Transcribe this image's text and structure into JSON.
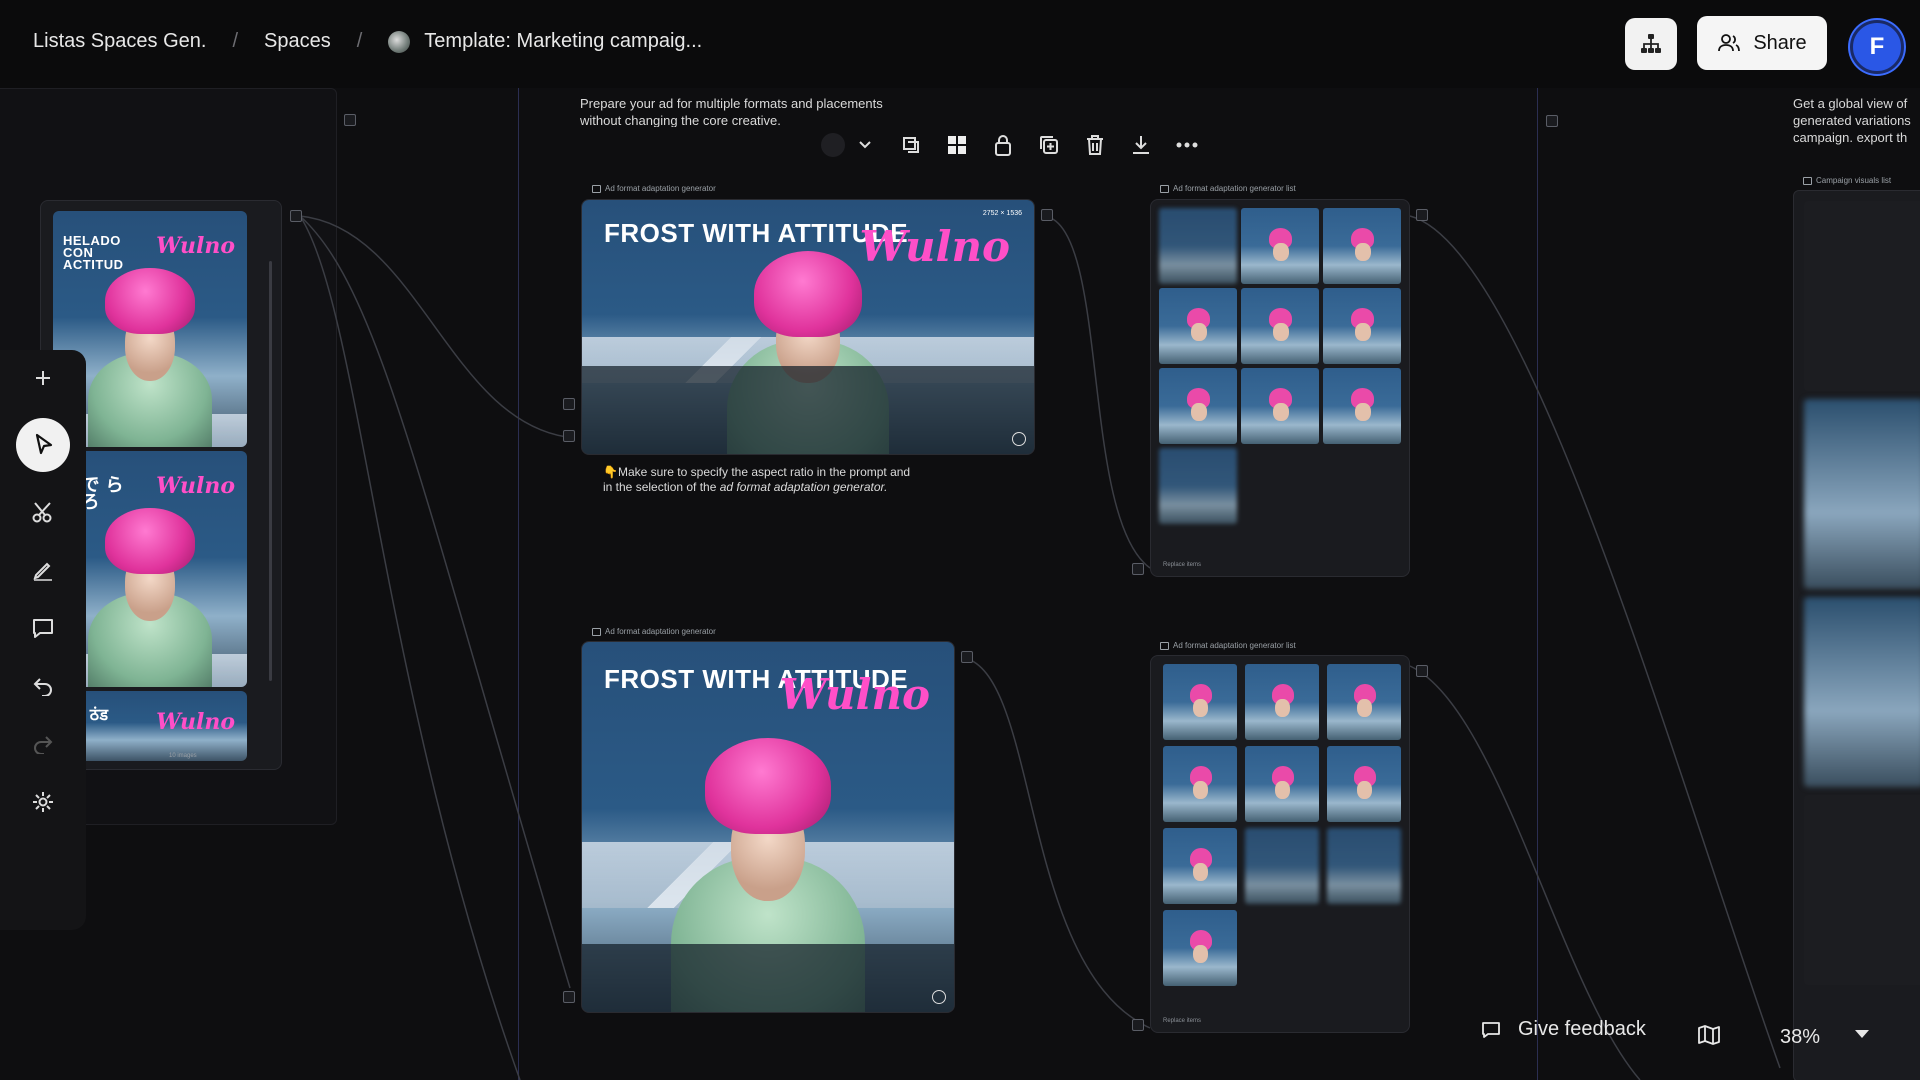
{
  "breadcrumb": {
    "items": [
      "Listas Spaces Gen.",
      "Spaces",
      "Template: Marketing campaig..."
    ],
    "separator": "/"
  },
  "header": {
    "share_label": "Share",
    "avatar_initial": "F"
  },
  "canvas": {
    "left_note": "",
    "top_note": "Prepare your ad for multiple formats and placements without changing the core creative.",
    "right_note": "Get a global view of generated variations campaign. export th and keep your work",
    "instruction_note_line1": "👇Make sure to specify the aspect ratio in the prompt and",
    "instruction_note_line2_prefix": "in the selection of the ",
    "instruction_note_line2_emph": "ad format adaptation generator.",
    "node_labels": {
      "gen1": "Ad format adaptation generator",
      "list1": "Ad format adaptation generator list",
      "gen2": "Ad format adaptation generator",
      "list2": "Ad format adaptation generator list",
      "campaign_list": "Campaign visuals list"
    },
    "ad": {
      "headline": "FROST WITH ATTITUDE",
      "brand": "Wulno",
      "dimensions": "2752 × 1536",
      "left_headline": "HELADO CON ACTITUD",
      "left_jp": "度で らせろ",
      "left_hi": "कह ठंड"
    },
    "list_footer_label": "Replace items",
    "left_list_footer": "10 images"
  },
  "toolbar": {
    "items": [
      "color-swatch",
      "chevron-down",
      "frame",
      "grid",
      "lock",
      "duplicate",
      "delete",
      "download",
      "more"
    ]
  },
  "left_tools": [
    "add",
    "select",
    "cut",
    "draw",
    "comment",
    "undo",
    "redo",
    "settings"
  ],
  "footer": {
    "feedback_label": "Give feedback",
    "zoom_value": "38%"
  }
}
